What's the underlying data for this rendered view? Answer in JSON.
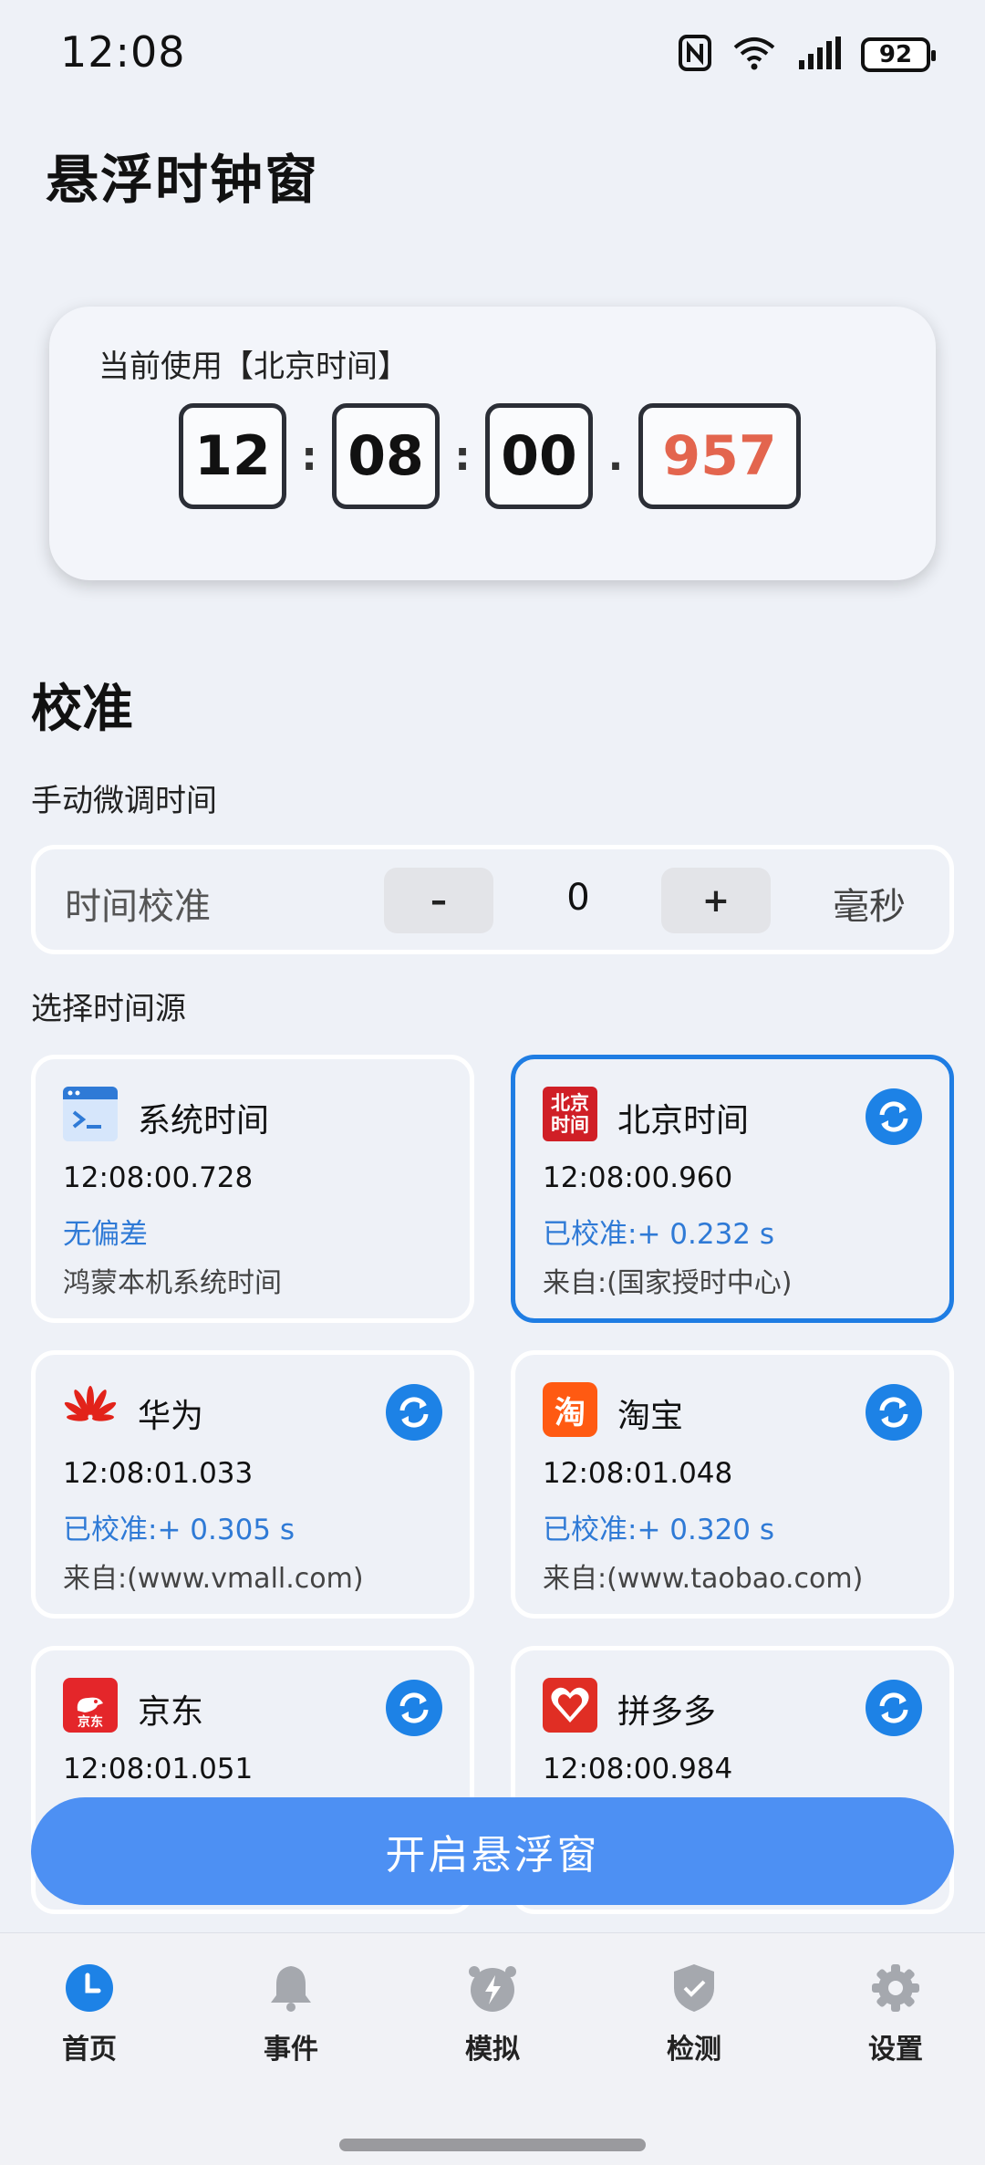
{
  "status_bar": {
    "time": "12:08",
    "battery": "92"
  },
  "app": {
    "title": "悬浮时钟窗"
  },
  "clock": {
    "caption": "当前使用【北京时间】",
    "hours": "12",
    "minutes": "08",
    "seconds": "00",
    "millis": "957",
    "sep_colon": ":",
    "sep_dot": "."
  },
  "calibration": {
    "section_title": "校准",
    "manual_label": "手动微调时间",
    "field_label": "时间校准",
    "minus_label": "–",
    "plus_label": "+",
    "value": "0",
    "unit": "毫秒"
  },
  "sources": {
    "label": "选择时间源",
    "items": [
      {
        "name": "系统时间",
        "time": "12:08:00.728",
        "status": "无偏差",
        "from": "鸿蒙本机系统时间",
        "selected": false,
        "logo": "terminal-icon"
      },
      {
        "name": "北京时间",
        "time": "12:08:00.960",
        "status": "已校准:+ 0.232 s",
        "from": "来自:(国家授时中心)",
        "selected": true,
        "logo": "beijing-time-icon",
        "logo_text_1": "北京",
        "logo_text_2": "时间"
      },
      {
        "name": "华为",
        "time": "12:08:01.033",
        "status": "已校准:+ 0.305 s",
        "from": "来自:(www.vmall.com)",
        "selected": false,
        "logo": "huawei-icon"
      },
      {
        "name": "淘宝",
        "time": "12:08:01.048",
        "status": "已校准:+ 0.320 s",
        "from": "来自:(www.taobao.com)",
        "selected": false,
        "logo": "taobao-icon",
        "logo_text": "淘"
      },
      {
        "name": "京东",
        "time": "12:08:01.051",
        "status": "",
        "from": "",
        "selected": false,
        "logo": "jd-icon",
        "logo_text": "京东"
      },
      {
        "name": "拼多多",
        "time": "12:08:00.984",
        "status": "",
        "from": "",
        "selected": false,
        "logo": "pinduoduo-icon"
      }
    ]
  },
  "float_button": {
    "label": "开启悬浮窗"
  },
  "nav": [
    {
      "label": "首页",
      "icon": "clock-icon"
    },
    {
      "label": "事件",
      "icon": "bell-icon"
    },
    {
      "label": "模拟",
      "icon": "lightning-icon"
    },
    {
      "label": "检测",
      "icon": "shield-icon"
    },
    {
      "label": "设置",
      "icon": "gear-icon"
    }
  ],
  "colors": {
    "accent": "#1d82e6",
    "button": "#4d90f3",
    "millis": "#e3654e",
    "status": "#2f7ad6"
  }
}
